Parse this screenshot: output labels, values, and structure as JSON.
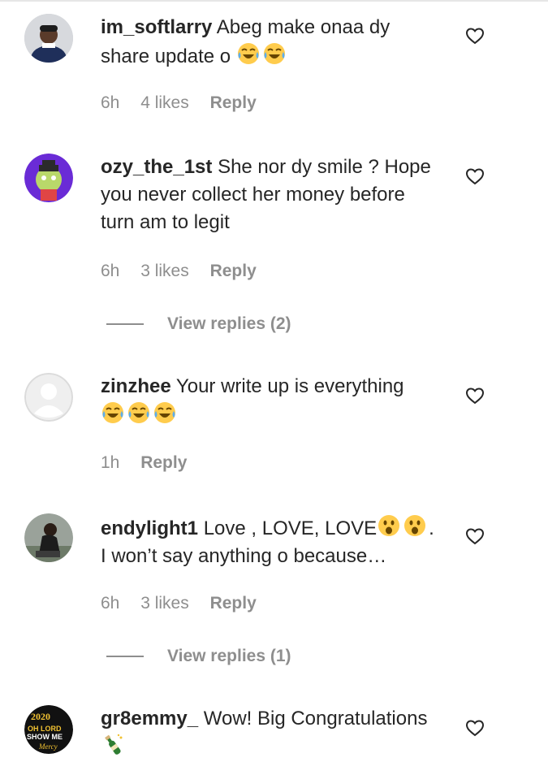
{
  "comments": [
    {
      "username": "im_softlarry",
      "text": "Abeg make onaa dy share update o",
      "emoji": [
        "face-with-tears-of-joy",
        "face-with-tears-of-joy"
      ],
      "time": "6h",
      "likes": "4 likes",
      "reply": "Reply"
    },
    {
      "username": "ozy_the_1st",
      "text": "She nor dy smile ? Hope you never collect her money before turn am to legit",
      "time": "6h",
      "likes": "3 likes",
      "reply": "Reply",
      "view_replies": "View replies (2)"
    },
    {
      "username": "zinzhee",
      "text": "Your write up is everything",
      "emoji": [
        "face-with-tears-of-joy",
        "face-with-tears-of-joy",
        "face-with-tears-of-joy"
      ],
      "time": "1h",
      "reply": "Reply"
    },
    {
      "username": "endylight1",
      "text_before": "Love , LOVE, LOVE",
      "emoji": [
        "face-with-open-mouth",
        "face-with-open-mouth"
      ],
      "text_after": ". I won’t say anything o because…",
      "time": "6h",
      "likes": "3 likes",
      "reply": "Reply",
      "view_replies": "View replies (1)"
    },
    {
      "username": "gr8emmy_",
      "text": "Wow! Big Congratulations",
      "emoji": [
        "bottle-with-popping-cork"
      ],
      "avatar_text": [
        "2020",
        "OH LORD",
        "SHOW ME",
        "Mercy"
      ]
    }
  ],
  "colors": {
    "text": "#262626",
    "secondary": "#8e8e8e",
    "emoji_yellow": "#ffcc4d",
    "emoji_tear": "#5dadec"
  }
}
